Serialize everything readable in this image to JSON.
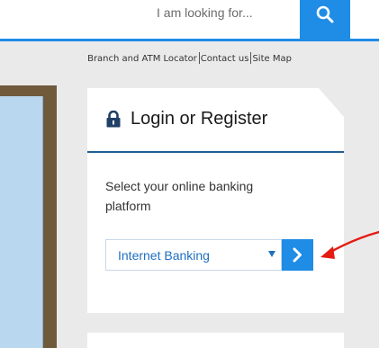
{
  "header": {
    "search": {
      "placeholder": "I am looking for..."
    }
  },
  "utility_nav": {
    "links": [
      {
        "label": "Branch and ATM Locator"
      },
      {
        "label": "Contact us"
      },
      {
        "label": "Site Map"
      }
    ]
  },
  "login": {
    "title": "Login or Register",
    "prompt": "Select your online banking platform",
    "platform_select": {
      "selected": "Internet Banking"
    }
  },
  "icons": {
    "search": "magnifier-icon",
    "lock": "lock-icon",
    "go": "chevron-right-icon",
    "dropdown": "triangle-down-icon",
    "annotation": "red-arrow-icon"
  },
  "colors": {
    "brand_blue": "#1f8ce6",
    "link_blue": "#1f6fc0",
    "header_rule": "#1f5e96",
    "page_bg": "#eaeaea",
    "annotation_red": "#e41b13"
  }
}
